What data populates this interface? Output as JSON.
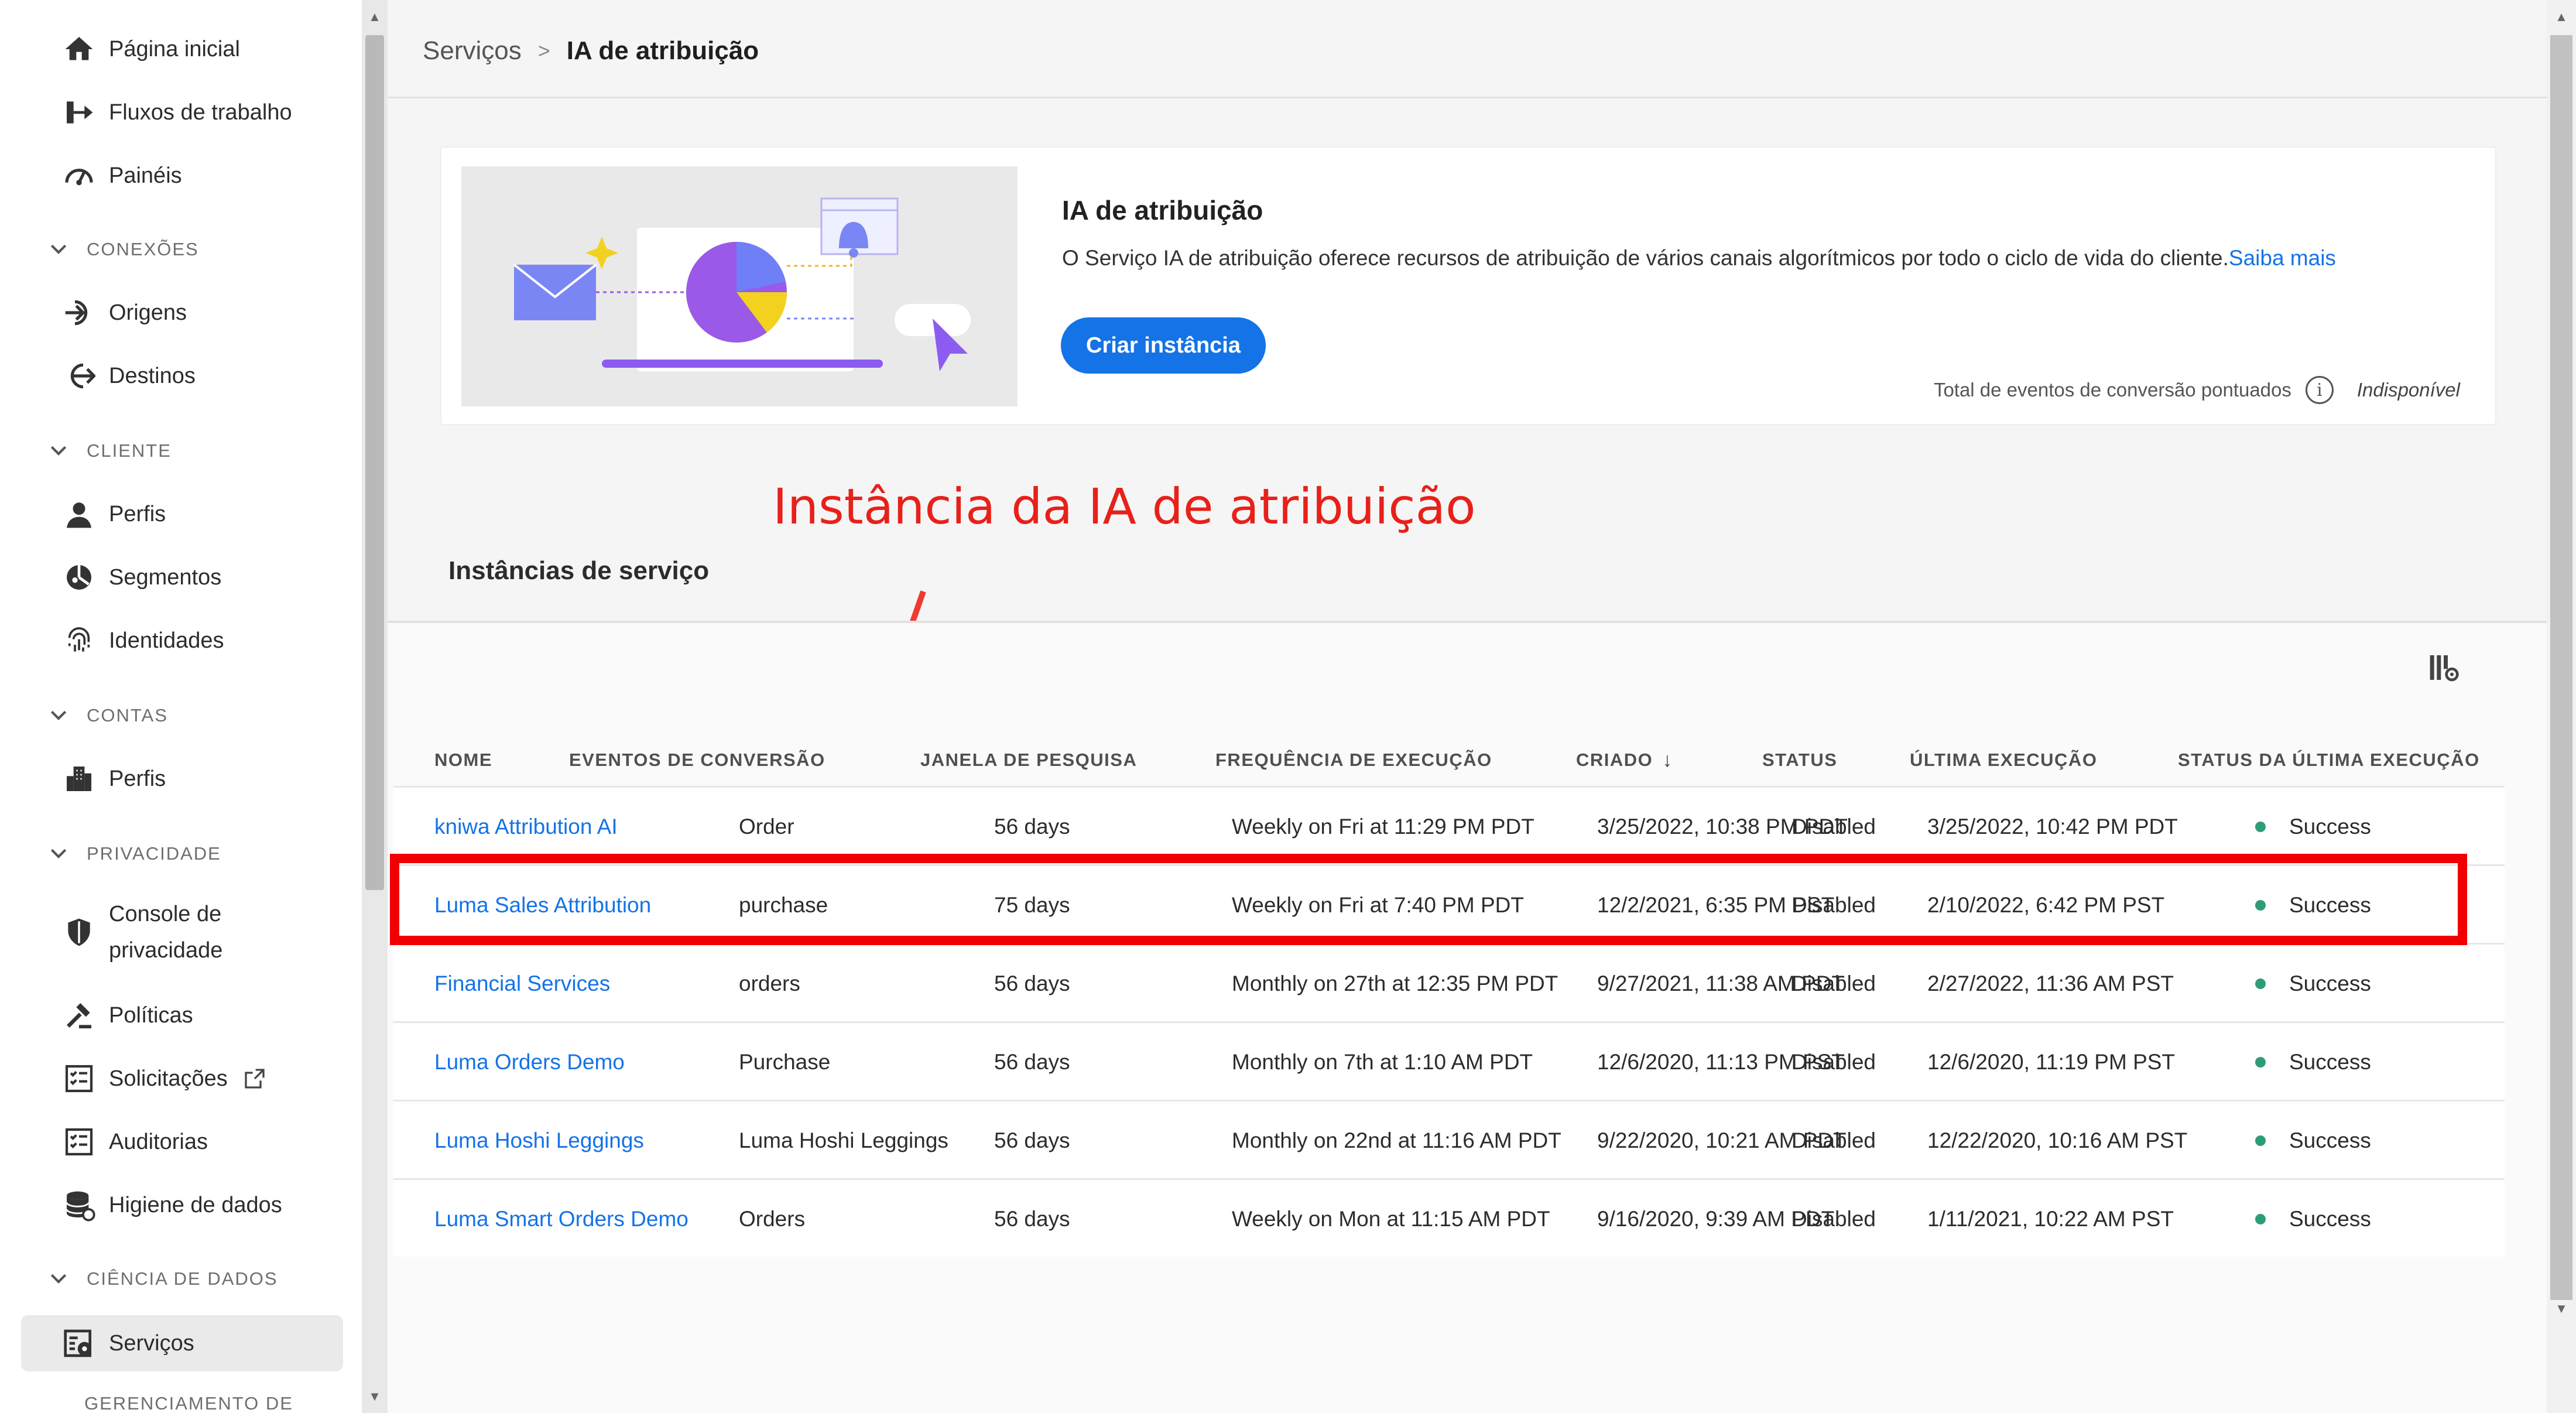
{
  "sidebar": {
    "items": [
      {
        "label": "Página inicial",
        "icon": "home-icon"
      },
      {
        "label": "Fluxos de trabalho",
        "icon": "workflow-icon"
      },
      {
        "label": "Painéis",
        "icon": "dashboard-icon"
      },
      {
        "label": "Origens",
        "icon": "sources-icon"
      },
      {
        "label": "Destinos",
        "icon": "destinations-icon"
      },
      {
        "label": "Perfis",
        "icon": "user-icon"
      },
      {
        "label": "Segmentos",
        "icon": "segments-icon"
      },
      {
        "label": "Identidades",
        "icon": "fingerprint-icon"
      },
      {
        "label": "Perfis",
        "icon": "building-icon"
      },
      {
        "label": "Console de",
        "label2": "privacidade",
        "icon": "shield-icon"
      },
      {
        "label": "Políticas",
        "icon": "gavel-icon"
      },
      {
        "label": "Solicitações",
        "icon": "checklist-icon"
      },
      {
        "label": "Auditorias",
        "icon": "checklist-icon"
      },
      {
        "label": "Higiene de dados",
        "icon": "database-icon"
      },
      {
        "label": "Serviços",
        "icon": "services-icon"
      }
    ],
    "sections": [
      "CONEXÕES",
      "CLIENTE",
      "CONTAS",
      "PRIVACIDADE",
      "CIÊNCIA DE DADOS",
      "GERENCIAMENTO DE"
    ],
    "selected": "Serviços"
  },
  "breadcrumb": {
    "parent": "Serviços",
    "separator": ">",
    "current": "IA de atribuição"
  },
  "hero": {
    "title": "IA de atribuição",
    "description": "O Serviço IA de atribuição oferece recursos de atribuição de vários canais algorítmicos por todo o ciclo de vida do cliente.",
    "learn_more": "Saiba mais",
    "create_button": "Criar instância",
    "metric_label": "Total de eventos de conversão pontuados",
    "metric_value": "Indisponível",
    "info_glyph": "i"
  },
  "annotation": {
    "text": "Instância da IA de atribuição",
    "color": "#e7211a"
  },
  "instances": {
    "title": "Instâncias de serviço",
    "columns": [
      "NOME",
      "EVENTOS DE CONVERSÃO",
      "JANELA DE PESQUISA",
      "FREQUÊNCIA DE EXECUÇÃO",
      "CRIADO",
      "STATUS",
      "ÚLTIMA EXECUÇÃO",
      "STATUS DA ÚLTIMA EXECUÇÃO"
    ],
    "sort_glyph": "↓",
    "rows": [
      {
        "name": "kniwa Attribution AI",
        "event": "Order",
        "window": "56 days",
        "frequency": "Weekly on Fri at 11:29 PM PDT",
        "created": "3/25/2022, 10:38 PM PDT",
        "status": "Disabled",
        "last_run": "3/25/2022, 10:42 PM PDT",
        "last_status": "Success"
      },
      {
        "name": "Luma Sales Attribution",
        "event": "purchase",
        "window": "75 days",
        "frequency": "Weekly on Fri at 7:40 PM PDT",
        "created": "12/2/2021, 6:35 PM PST",
        "status": "Disabled",
        "last_run": "2/10/2022, 6:42 PM PST",
        "last_status": "Success"
      },
      {
        "name": "Financial Services",
        "event": "orders",
        "window": "56 days",
        "frequency": "Monthly on 27th at 12:35 PM PDT",
        "created": "9/27/2021, 11:38 AM PDT",
        "status": "Disabled",
        "last_run": "2/27/2022, 11:36 AM PST",
        "last_status": "Success"
      },
      {
        "name": "Luma Orders Demo",
        "event": "Purchase",
        "window": "56 days",
        "frequency": "Monthly on 7th at 1:10 AM PDT",
        "created": "12/6/2020, 11:13 PM PST",
        "status": "Disabled",
        "last_run": "12/6/2020, 11:19 PM PST",
        "last_status": "Success"
      },
      {
        "name": "Luma Hoshi Leggings",
        "event": "Luma Hoshi Leggings",
        "window": "56 days",
        "frequency": "Monthly on 22nd at 11:16 AM PDT",
        "created": "9/22/2020, 10:21 AM PDT",
        "status": "Disabled",
        "last_run": "12/22/2020, 10:16 AM PST",
        "last_status": "Success"
      },
      {
        "name": "Luma Smart Orders Demo",
        "event": "Orders",
        "window": "56 days",
        "frequency": "Weekly on Mon at 11:15 AM PDT",
        "created": "9/16/2020, 9:39 AM PDT",
        "status": "Disabled",
        "last_run": "1/11/2021, 10:22 AM PST",
        "last_status": "Success"
      }
    ]
  },
  "colors": {
    "accent": "#1473e6",
    "success": "#2d9d78",
    "highlight": "#f00000"
  }
}
